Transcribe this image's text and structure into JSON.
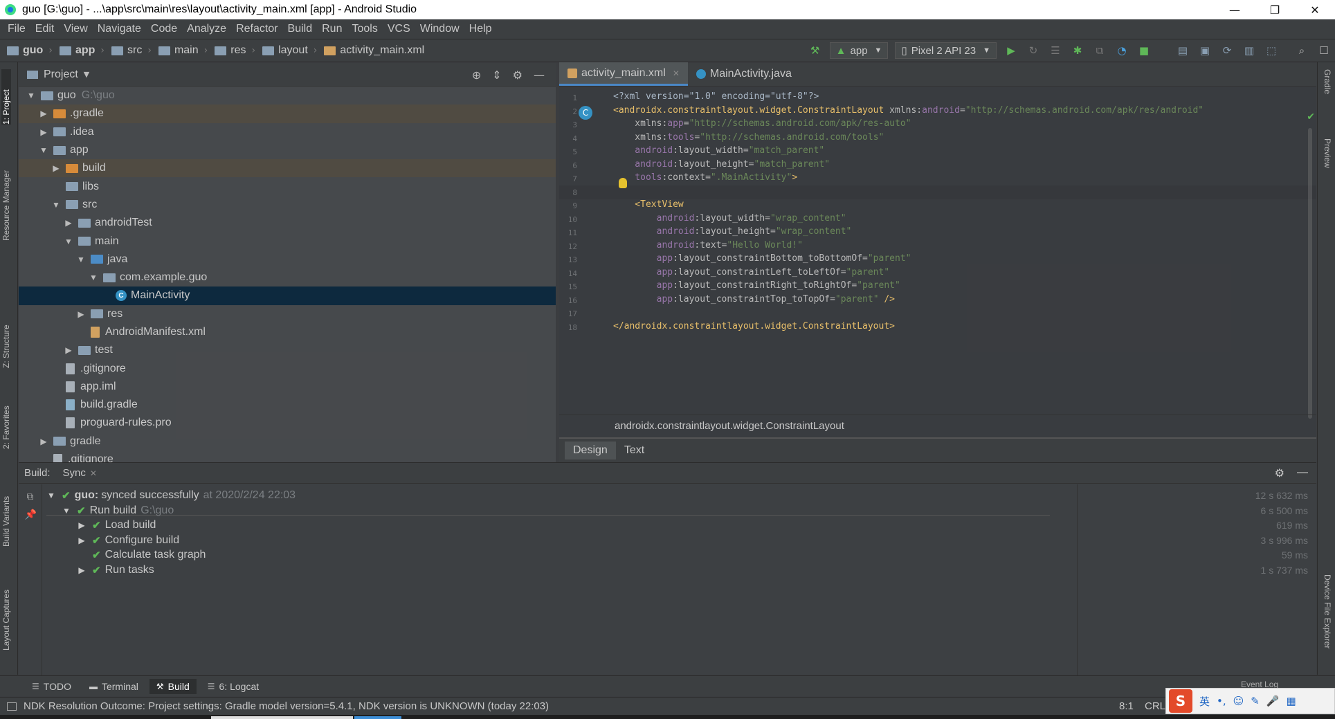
{
  "window": {
    "title": "guo [G:\\guo] - ...\\app\\src\\main\\res\\layout\\activity_main.xml [app] - Android Studio",
    "buttons": [
      "—",
      "❐",
      "✕"
    ]
  },
  "menu": [
    "File",
    "Edit",
    "View",
    "Navigate",
    "Code",
    "Analyze",
    "Refactor",
    "Build",
    "Run",
    "Tools",
    "VCS",
    "Window",
    "Help"
  ],
  "breadcrumb": [
    "guo",
    "app",
    "src",
    "main",
    "res",
    "layout",
    "activity_main.xml"
  ],
  "toolbar": {
    "run_config": "app",
    "device": "Pixel 2 API 23"
  },
  "left_tool_tabs": [
    "1: Project",
    "Resource Manager",
    "Z: Structure",
    "2: Favorites",
    "Build Variants",
    "Layout Captures"
  ],
  "right_tool_tabs": [
    "Gradle",
    "Preview",
    "Device File Explorer"
  ],
  "project_panel": {
    "title": "Project",
    "tree": [
      {
        "label": "guo",
        "hint": "G:\\guo",
        "depth": 0,
        "twisty": "▼",
        "icon": "folder"
      },
      {
        "label": ".gradle",
        "depth": 1,
        "twisty": "▶",
        "icon": "folder-orange",
        "highlight": "orange"
      },
      {
        "label": ".idea",
        "depth": 1,
        "twisty": "▶",
        "icon": "folder"
      },
      {
        "label": "app",
        "depth": 1,
        "twisty": "▼",
        "icon": "folder"
      },
      {
        "label": "build",
        "depth": 2,
        "twisty": "▶",
        "icon": "folder-orange",
        "highlight": "orange"
      },
      {
        "label": "libs",
        "depth": 2,
        "twisty": "",
        "icon": "folder"
      },
      {
        "label": "src",
        "depth": 2,
        "twisty": "▼",
        "icon": "folder"
      },
      {
        "label": "androidTest",
        "depth": 3,
        "twisty": "▶",
        "icon": "folder"
      },
      {
        "label": "main",
        "depth": 3,
        "twisty": "▼",
        "icon": "folder"
      },
      {
        "label": "java",
        "depth": 4,
        "twisty": "▼",
        "icon": "folder-blue"
      },
      {
        "label": "com.example.guo",
        "depth": 5,
        "twisty": "▼",
        "icon": "folder"
      },
      {
        "label": "MainActivity",
        "depth": 6,
        "twisty": "",
        "icon": "class",
        "highlight": "selected"
      },
      {
        "label": "res",
        "depth": 4,
        "twisty": "▶",
        "icon": "folder"
      },
      {
        "label": "AndroidManifest.xml",
        "depth": 4,
        "twisty": "",
        "icon": "file-xml"
      },
      {
        "label": "test",
        "depth": 3,
        "twisty": "▶",
        "icon": "folder"
      },
      {
        "label": ".gitignore",
        "depth": 2,
        "twisty": "",
        "icon": "file"
      },
      {
        "label": "app.iml",
        "depth": 2,
        "twisty": "",
        "icon": "file"
      },
      {
        "label": "build.gradle",
        "depth": 2,
        "twisty": "",
        "icon": "file-gradle"
      },
      {
        "label": "proguard-rules.pro",
        "depth": 2,
        "twisty": "",
        "icon": "file"
      },
      {
        "label": "gradle",
        "depth": 1,
        "twisty": "▶",
        "icon": "folder"
      },
      {
        "label": ".gitignore",
        "depth": 1,
        "twisty": "",
        "icon": "file"
      }
    ]
  },
  "editor": {
    "tabs": [
      {
        "label": "activity_main.xml",
        "active": true
      },
      {
        "label": "MainActivity.java",
        "active": false
      }
    ],
    "lines": [
      [
        {
          "c": "t-pi",
          "t": "<?xml version=\"1.0\" encoding=\"utf-8\"?>"
        }
      ],
      [
        {
          "c": "t-tag",
          "t": "<androidx.constraintlayout.widget.ConstraintLayout "
        },
        {
          "c": "t-attr",
          "t": "xmlns:"
        },
        {
          "c": "t-ns",
          "t": "android"
        },
        {
          "c": "t-attr",
          "t": "="
        },
        {
          "c": "t-val",
          "t": "\"http://schemas.android.com/apk/res/android\""
        }
      ],
      [
        {
          "c": "t-attr",
          "t": "    xmlns:"
        },
        {
          "c": "t-ns",
          "t": "app"
        },
        {
          "c": "t-attr",
          "t": "="
        },
        {
          "c": "t-val",
          "t": "\"http://schemas.android.com/apk/res-auto\""
        }
      ],
      [
        {
          "c": "t-attr",
          "t": "    xmlns:"
        },
        {
          "c": "t-ns",
          "t": "tools"
        },
        {
          "c": "t-attr",
          "t": "="
        },
        {
          "c": "t-val",
          "t": "\"http://schemas.android.com/tools\""
        }
      ],
      [
        {
          "c": "t-ns",
          "t": "    android"
        },
        {
          "c": "t-attr",
          "t": ":layout_width="
        },
        {
          "c": "t-val",
          "t": "\"match_parent\""
        }
      ],
      [
        {
          "c": "t-ns",
          "t": "    android"
        },
        {
          "c": "t-attr",
          "t": ":layout_height="
        },
        {
          "c": "t-val",
          "t": "\"match_parent\""
        }
      ],
      [
        {
          "c": "t-ns",
          "t": "    tools"
        },
        {
          "c": "t-attr",
          "t": ":context="
        },
        {
          "c": "t-val",
          "t": "\".MainActivity\""
        },
        {
          "c": "t-tag",
          "t": ">"
        }
      ],
      [],
      [
        {
          "c": "t-tag",
          "t": "    <TextView"
        }
      ],
      [
        {
          "c": "t-ns",
          "t": "        android"
        },
        {
          "c": "t-attr",
          "t": ":layout_width="
        },
        {
          "c": "t-val",
          "t": "\"wrap_content\""
        }
      ],
      [
        {
          "c": "t-ns",
          "t": "        android"
        },
        {
          "c": "t-attr",
          "t": ":layout_height="
        },
        {
          "c": "t-val",
          "t": "\"wrap_content\""
        }
      ],
      [
        {
          "c": "t-ns",
          "t": "        android"
        },
        {
          "c": "t-attr",
          "t": ":text="
        },
        {
          "c": "t-val",
          "t": "\"Hello World!\""
        }
      ],
      [
        {
          "c": "t-ns",
          "t": "        app"
        },
        {
          "c": "t-attr",
          "t": ":layout_constraintBottom_toBottomOf="
        },
        {
          "c": "t-val",
          "t": "\"parent\""
        }
      ],
      [
        {
          "c": "t-ns",
          "t": "        app"
        },
        {
          "c": "t-attr",
          "t": ":layout_constraintLeft_toLeftOf="
        },
        {
          "c": "t-val",
          "t": "\"parent\""
        }
      ],
      [
        {
          "c": "t-ns",
          "t": "        app"
        },
        {
          "c": "t-attr",
          "t": ":layout_constraintRight_toRightOf="
        },
        {
          "c": "t-val",
          "t": "\"parent\""
        }
      ],
      [
        {
          "c": "t-ns",
          "t": "        app"
        },
        {
          "c": "t-attr",
          "t": ":layout_constraintTop_toTopOf="
        },
        {
          "c": "t-val",
          "t": "\"parent\""
        },
        {
          "c": "t-tag",
          "t": " />"
        }
      ],
      [],
      [
        {
          "c": "t-tag",
          "t": "</androidx.constraintlayout.widget.ConstraintLayout>"
        }
      ]
    ],
    "breadcrumb": "androidx.constraintlayout.widget.ConstraintLayout",
    "view_tabs": [
      "Design",
      "Text"
    ],
    "active_view_tab": "Design"
  },
  "build_panel": {
    "label": "Build:",
    "tab": "Sync",
    "rows": [
      {
        "depth": 0,
        "twisty": "▼",
        "bold": "guo:",
        "text": "synced successfully",
        "dim": "at 2020/2/24 22:03",
        "duration": "12 s 632 ms"
      },
      {
        "depth": 1,
        "twisty": "▼",
        "text": "Run build",
        "dim": "G:\\guo",
        "duration": "6 s 500 ms"
      },
      {
        "depth": 2,
        "twisty": "▶",
        "text": "Load build",
        "duration": "619 ms"
      },
      {
        "depth": 2,
        "twisty": "▶",
        "text": "Configure build",
        "duration": "3 s 996 ms"
      },
      {
        "depth": 2,
        "twisty": "",
        "text": "Calculate task graph",
        "duration": "59 ms"
      },
      {
        "depth": 2,
        "twisty": "▶",
        "text": "Run tasks",
        "duration": "1 s 737 ms"
      }
    ]
  },
  "bottom_tabs": [
    {
      "label": "TODO",
      "icon": "☰"
    },
    {
      "label": "Terminal",
      "icon": "▬"
    },
    {
      "label": "Build",
      "icon": "🔨",
      "active": true
    },
    {
      "label": "6: Logcat",
      "icon": "☰"
    }
  ],
  "event_log": "Event Log",
  "status": {
    "message": "NDK Resolution Outcome: Project settings: Gradle model version=5.4.1, NDK version is UNKNOWN (today 22:03)",
    "caret": "8:1",
    "line_sep": "CRLF"
  },
  "ime": {
    "logo": "S",
    "lang": "英"
  }
}
